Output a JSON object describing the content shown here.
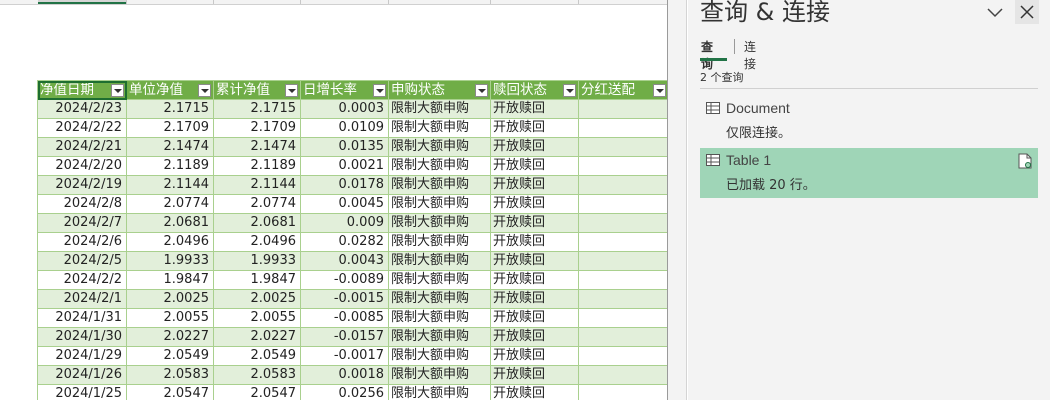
{
  "pane": {
    "title": "查询 & 连接",
    "tabs": {
      "queries": "查询",
      "connections": "连接"
    },
    "count": "2 个查询",
    "items": [
      {
        "name": "Document",
        "status": "仅限连接。"
      },
      {
        "name": "Table 1",
        "status": "已加载 20 行。"
      }
    ]
  },
  "table": {
    "headers": [
      "净值日期",
      "单位净值",
      "累计净值",
      "日增长率",
      "申购状态",
      "赎回状态",
      "分红送配"
    ],
    "rows": [
      [
        "2024/2/23",
        "2.1715",
        "2.1715",
        "0.0003",
        "限制大额申购",
        "开放赎回",
        ""
      ],
      [
        "2024/2/22",
        "2.1709",
        "2.1709",
        "0.0109",
        "限制大额申购",
        "开放赎回",
        ""
      ],
      [
        "2024/2/21",
        "2.1474",
        "2.1474",
        "0.0135",
        "限制大额申购",
        "开放赎回",
        ""
      ],
      [
        "2024/2/20",
        "2.1189",
        "2.1189",
        "0.0021",
        "限制大额申购",
        "开放赎回",
        ""
      ],
      [
        "2024/2/19",
        "2.1144",
        "2.1144",
        "0.0178",
        "限制大额申购",
        "开放赎回",
        ""
      ],
      [
        "2024/2/8",
        "2.0774",
        "2.0774",
        "0.0045",
        "限制大额申购",
        "开放赎回",
        ""
      ],
      [
        "2024/2/7",
        "2.0681",
        "2.0681",
        "0.009",
        "限制大额申购",
        "开放赎回",
        ""
      ],
      [
        "2024/2/6",
        "2.0496",
        "2.0496",
        "0.0282",
        "限制大额申购",
        "开放赎回",
        ""
      ],
      [
        "2024/2/5",
        "1.9933",
        "1.9933",
        "0.0043",
        "限制大额申购",
        "开放赎回",
        ""
      ],
      [
        "2024/2/2",
        "1.9847",
        "1.9847",
        "-0.0089",
        "限制大额申购",
        "开放赎回",
        ""
      ],
      [
        "2024/2/1",
        "2.0025",
        "2.0025",
        "-0.0015",
        "限制大额申购",
        "开放赎回",
        ""
      ],
      [
        "2024/1/31",
        "2.0055",
        "2.0055",
        "-0.0085",
        "限制大额申购",
        "开放赎回",
        ""
      ],
      [
        "2024/1/30",
        "2.0227",
        "2.0227",
        "-0.0157",
        "限制大额申购",
        "开放赎回",
        ""
      ],
      [
        "2024/1/29",
        "2.0549",
        "2.0549",
        "-0.0017",
        "限制大额申购",
        "开放赎回",
        ""
      ],
      [
        "2024/1/26",
        "2.0583",
        "2.0583",
        "0.0018",
        "限制大额申购",
        "开放赎回",
        ""
      ],
      [
        "2024/1/25",
        "2.0547",
        "2.0547",
        "0.0256",
        "限制大额申购",
        "开放赎回",
        ""
      ]
    ]
  },
  "colors": {
    "header_green": "#70ad47",
    "band_green": "#e2efda",
    "selected_query": "#9fd5b7",
    "accent": "#217346"
  }
}
